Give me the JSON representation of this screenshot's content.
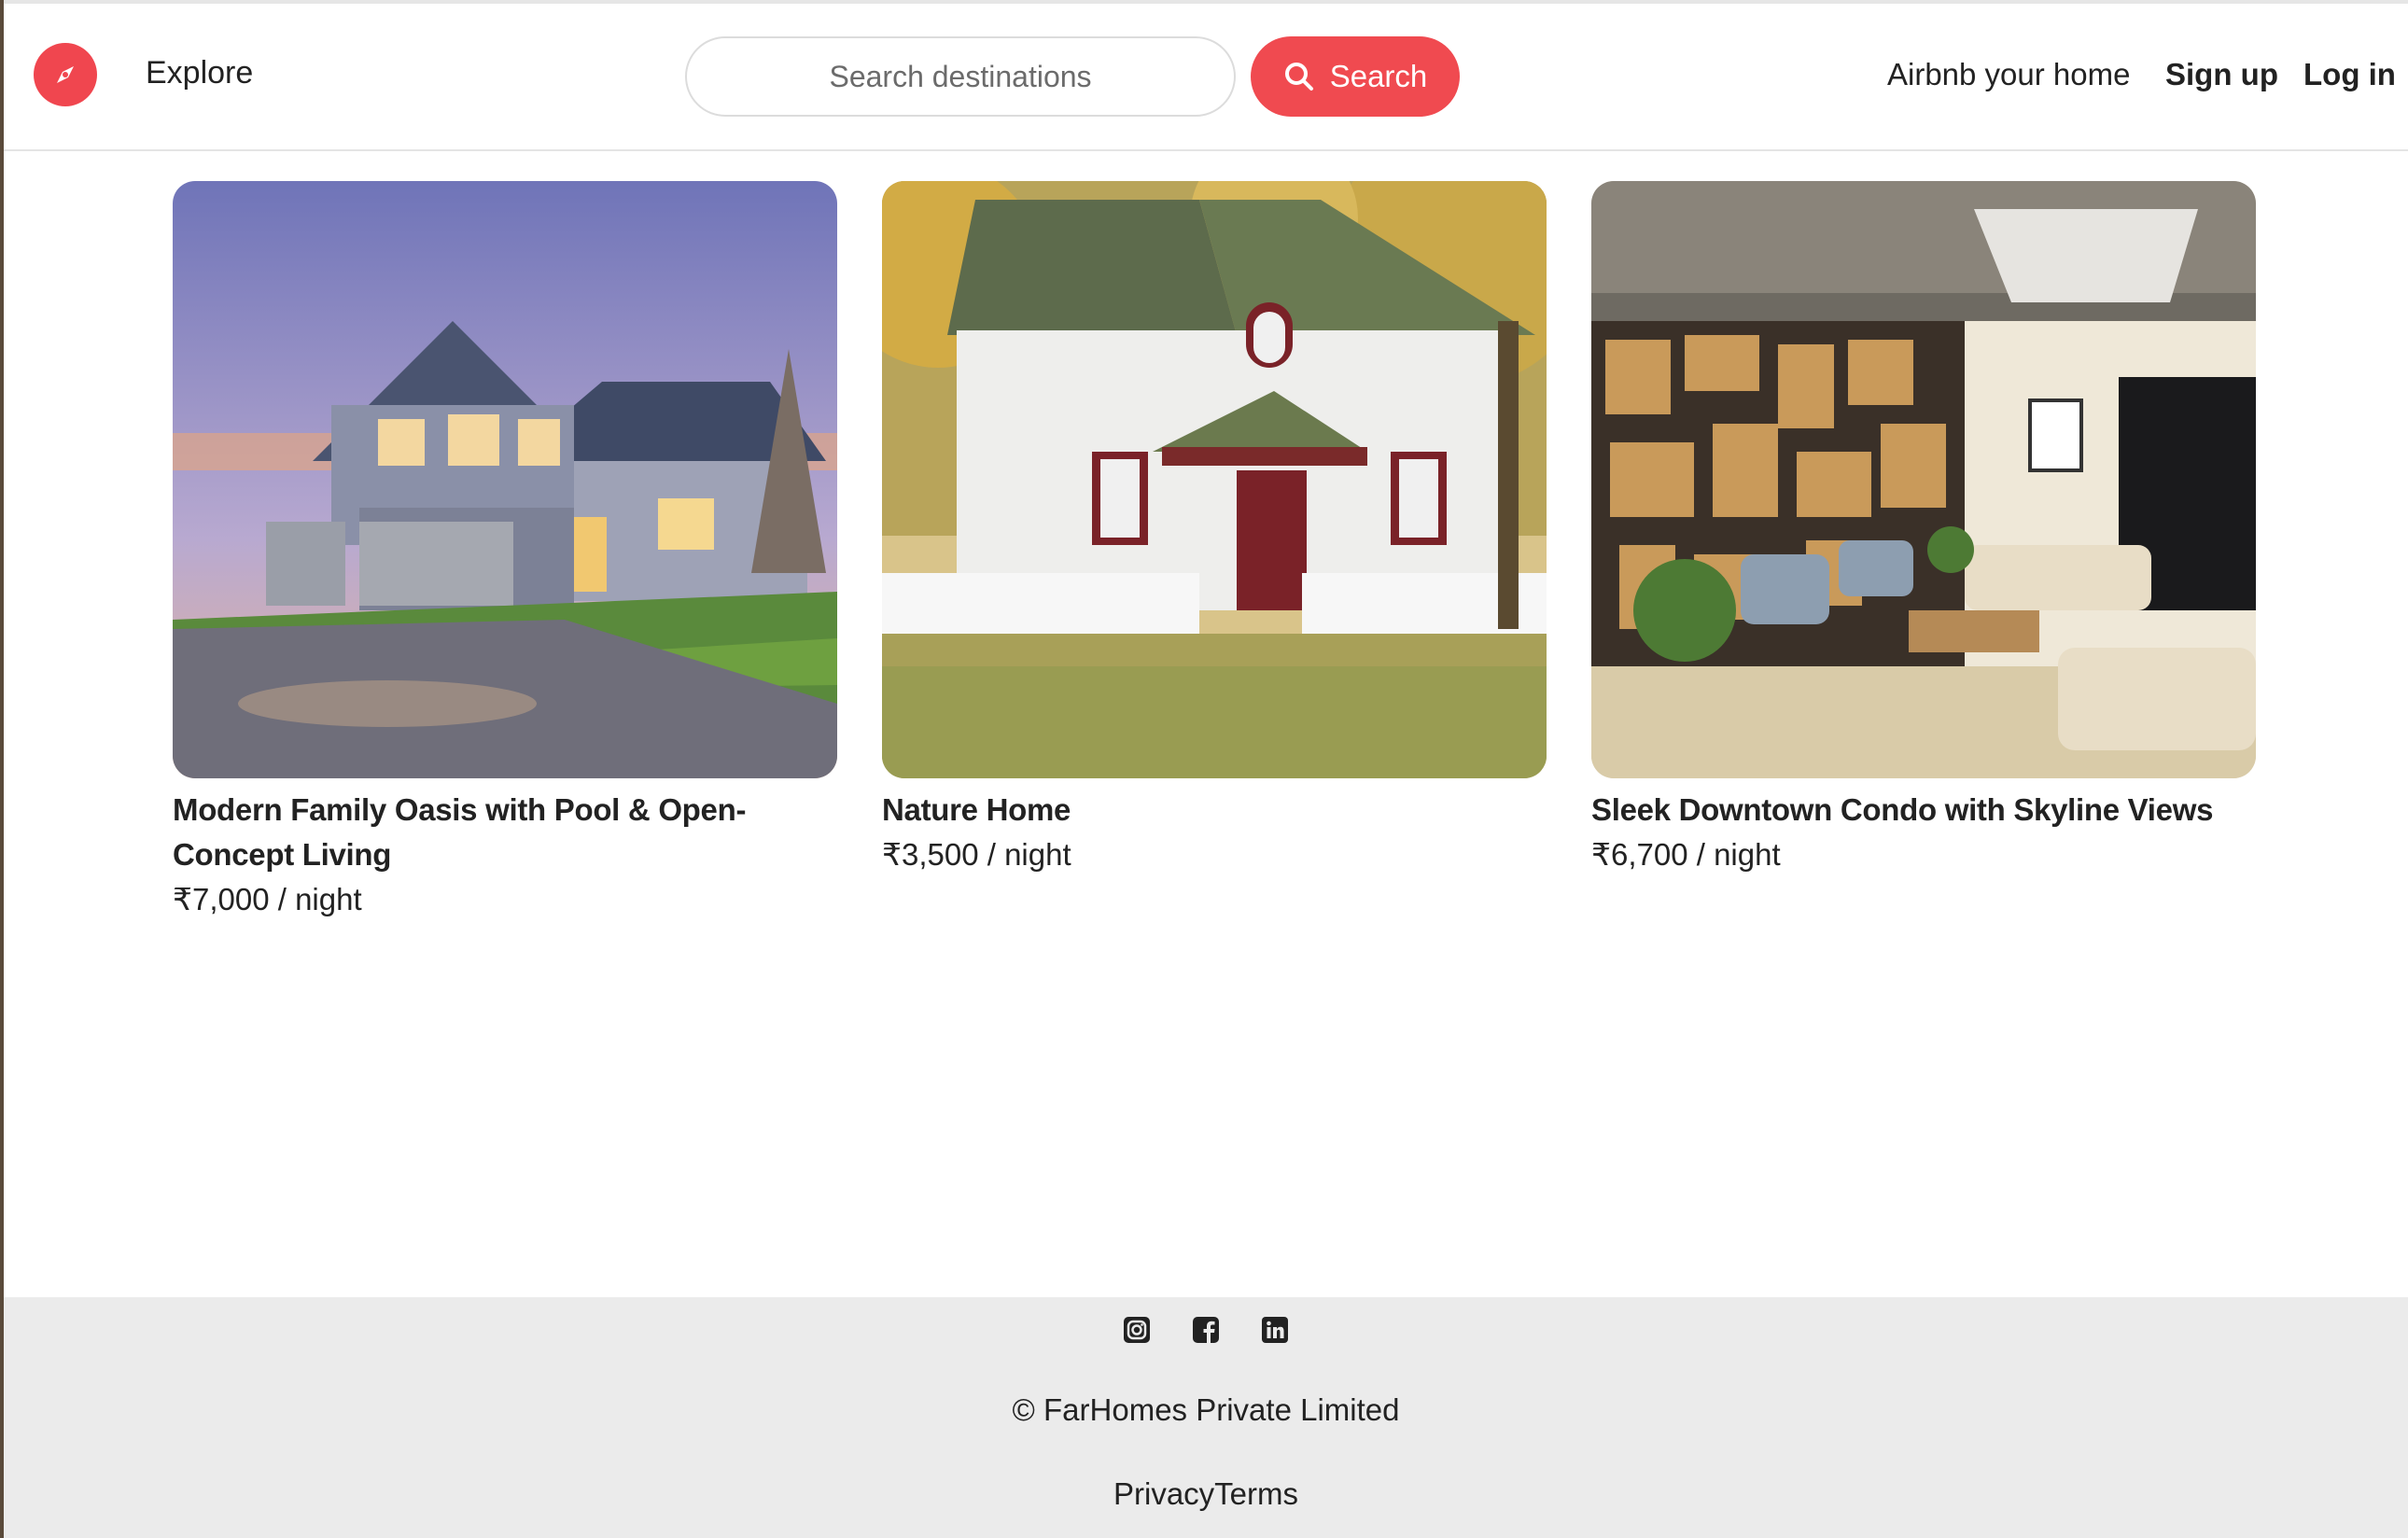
{
  "colors": {
    "brand": "#f04a50",
    "footer_bg": "#ebebeb",
    "text": "#222222"
  },
  "navbar": {
    "logo_icon": "compass-icon",
    "explore_label": "Explore",
    "search_placeholder": "Search destinations",
    "search_value": "",
    "search_button_label": "Search",
    "search_button_icon": "search-icon",
    "host_label": "Airbnb your home",
    "signup_label": "Sign up",
    "login_label": "Log in"
  },
  "listings": [
    {
      "title": "Modern Family Oasis with Pool & Open-Concept Living",
      "price": "₹7,000 / night",
      "image": "suburban-house-photo"
    },
    {
      "title": "Nature Home",
      "price": "₹3,500 / night",
      "image": "white-cottage-photo"
    },
    {
      "title": "Sleek Downtown Condo with Skyline Views",
      "price": "₹6,700 / night",
      "image": "condo-interior-photo"
    }
  ],
  "footer": {
    "social_icons": [
      "instagram-icon",
      "facebook-icon",
      "linkedin-icon"
    ],
    "copyright": "© FarHomes Private Limited",
    "privacy_label": "Privacy",
    "terms_label": "Terms"
  }
}
